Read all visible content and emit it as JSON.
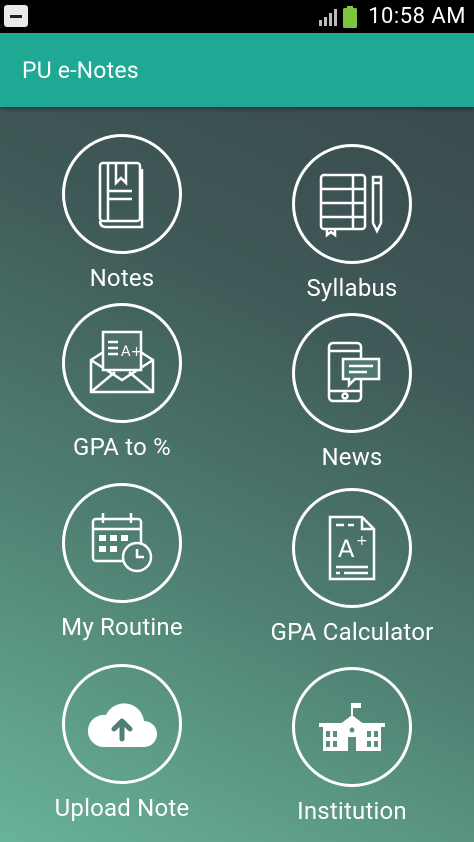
{
  "status_bar": {
    "time": "10:58 AM"
  },
  "app_bar": {
    "title": "PU e-Notes"
  },
  "menu": [
    {
      "label": "Notes",
      "icon": "book-icon"
    },
    {
      "label": "Syllabus",
      "icon": "notebook-pencil-icon"
    },
    {
      "label": "GPA to %",
      "icon": "envelope-grade-icon"
    },
    {
      "label": "News",
      "icon": "phone-message-icon"
    },
    {
      "label": "My Routine",
      "icon": "calendar-clock-icon"
    },
    {
      "label": "GPA Calculator",
      "icon": "grade-document-icon"
    },
    {
      "label": "Upload Note",
      "icon": "cloud-upload-icon"
    },
    {
      "label": "Institution",
      "icon": "school-building-icon"
    }
  ],
  "colors": {
    "app_bar": "#1fa894",
    "gradient_top": "#3a4a4d",
    "gradient_bottom": "#69b39a"
  }
}
